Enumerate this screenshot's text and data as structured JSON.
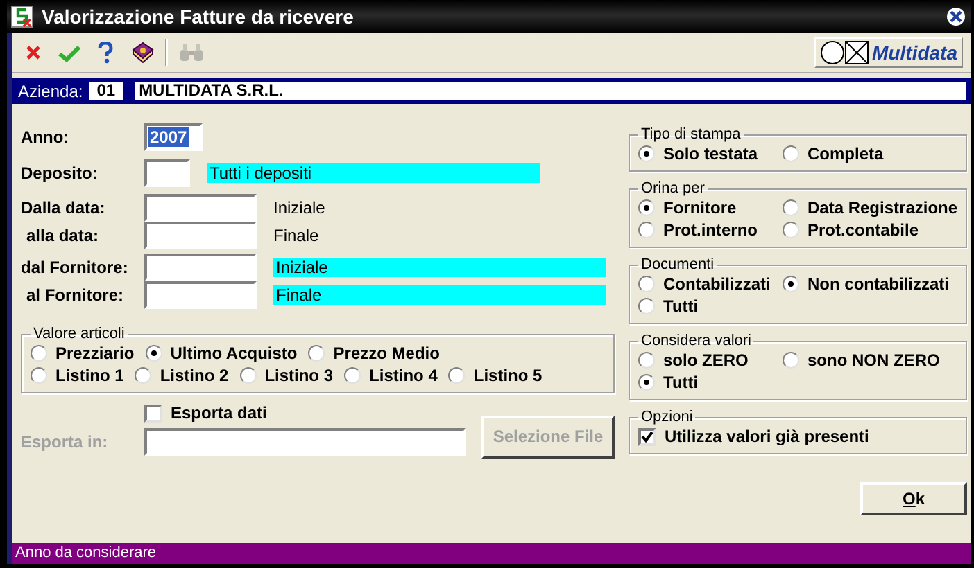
{
  "window": {
    "title": "Valorizzazione Fatture da ricevere"
  },
  "toolbar": [
    {
      "kind": "cancel",
      "disabled": false
    },
    {
      "kind": "confirm",
      "disabled": false
    },
    {
      "kind": "help",
      "disabled": false
    },
    {
      "kind": "book",
      "disabled": false
    },
    {
      "kind": "binoculars",
      "disabled": true
    }
  ],
  "logo": {
    "text": "Multidata"
  },
  "company": {
    "label": "Azienda:",
    "code": "01",
    "name": "MULTIDATA S.R.L."
  },
  "anno": {
    "label": "Anno:",
    "value": "2007",
    "highlighted": true
  },
  "deposito": {
    "label": "Deposito:",
    "description": "Tutti i depositi"
  },
  "date_range": [
    {
      "label": "Dalla data:",
      "hint": "Iniziale"
    },
    {
      "label": "alla data:",
      "hint": "Finale"
    }
  ],
  "supplier_range": [
    {
      "label": "dal Fornitore:",
      "description": "Iniziale"
    },
    {
      "label": "al Fornitore:",
      "description": "Finale"
    }
  ],
  "valore_articoli": {
    "title": "Valore articoli",
    "price_options": [
      {
        "label": "Prezziario",
        "selected": false
      },
      {
        "label": "Ultimo Acquisto",
        "selected": true
      },
      {
        "label": "Prezzo Medio",
        "selected": false
      }
    ],
    "list_options": [
      {
        "label": "Listino 1",
        "selected": false
      },
      {
        "label": "Listino 2",
        "selected": false
      },
      {
        "label": "Listino 3",
        "selected": false
      },
      {
        "label": "Listino 4",
        "selected": false
      },
      {
        "label": "Listino 5",
        "selected": false
      }
    ]
  },
  "export": {
    "checkbox": {
      "label": "Esporta dati",
      "checked": false
    },
    "label": "Esporta in:",
    "disabled": true,
    "button": "Selezione File"
  },
  "right_groups": [
    {
      "title": "Tipo di stampa",
      "options": [
        {
          "kind": "radio",
          "label": "Solo testata",
          "selected": true
        },
        {
          "kind": "radio",
          "label": "Completa",
          "selected": false
        }
      ]
    },
    {
      "title": "Orina per",
      "options": [
        {
          "kind": "radio",
          "label": "Fornitore",
          "selected": true
        },
        {
          "kind": "radio",
          "label": "Data Registrazione",
          "selected": false
        },
        {
          "kind": "radio",
          "label": "Prot.interno",
          "selected": false
        },
        {
          "kind": "radio",
          "label": "Prot.contabile",
          "selected": false
        }
      ]
    },
    {
      "title": "Documenti",
      "options": [
        {
          "kind": "radio",
          "label": "Contabilizzati",
          "selected": false
        },
        {
          "kind": "radio",
          "label": "Non contabilizzati",
          "selected": true
        },
        {
          "kind": "radio",
          "label": "Tutti",
          "selected": false
        }
      ]
    },
    {
      "title": "Considera valori",
      "options": [
        {
          "kind": "radio",
          "label": "solo ZERO",
          "selected": false
        },
        {
          "kind": "radio",
          "label": "sono NON ZERO",
          "selected": false
        },
        {
          "kind": "radio",
          "label": "Tutti",
          "selected": true
        }
      ]
    },
    {
      "title": "Opzioni",
      "options": [
        {
          "kind": "checkbox",
          "label": "Utilizza valori già presenti",
          "checked": true
        }
      ]
    }
  ],
  "ok_button": "Ok",
  "status_bar": "Anno da considerare"
}
